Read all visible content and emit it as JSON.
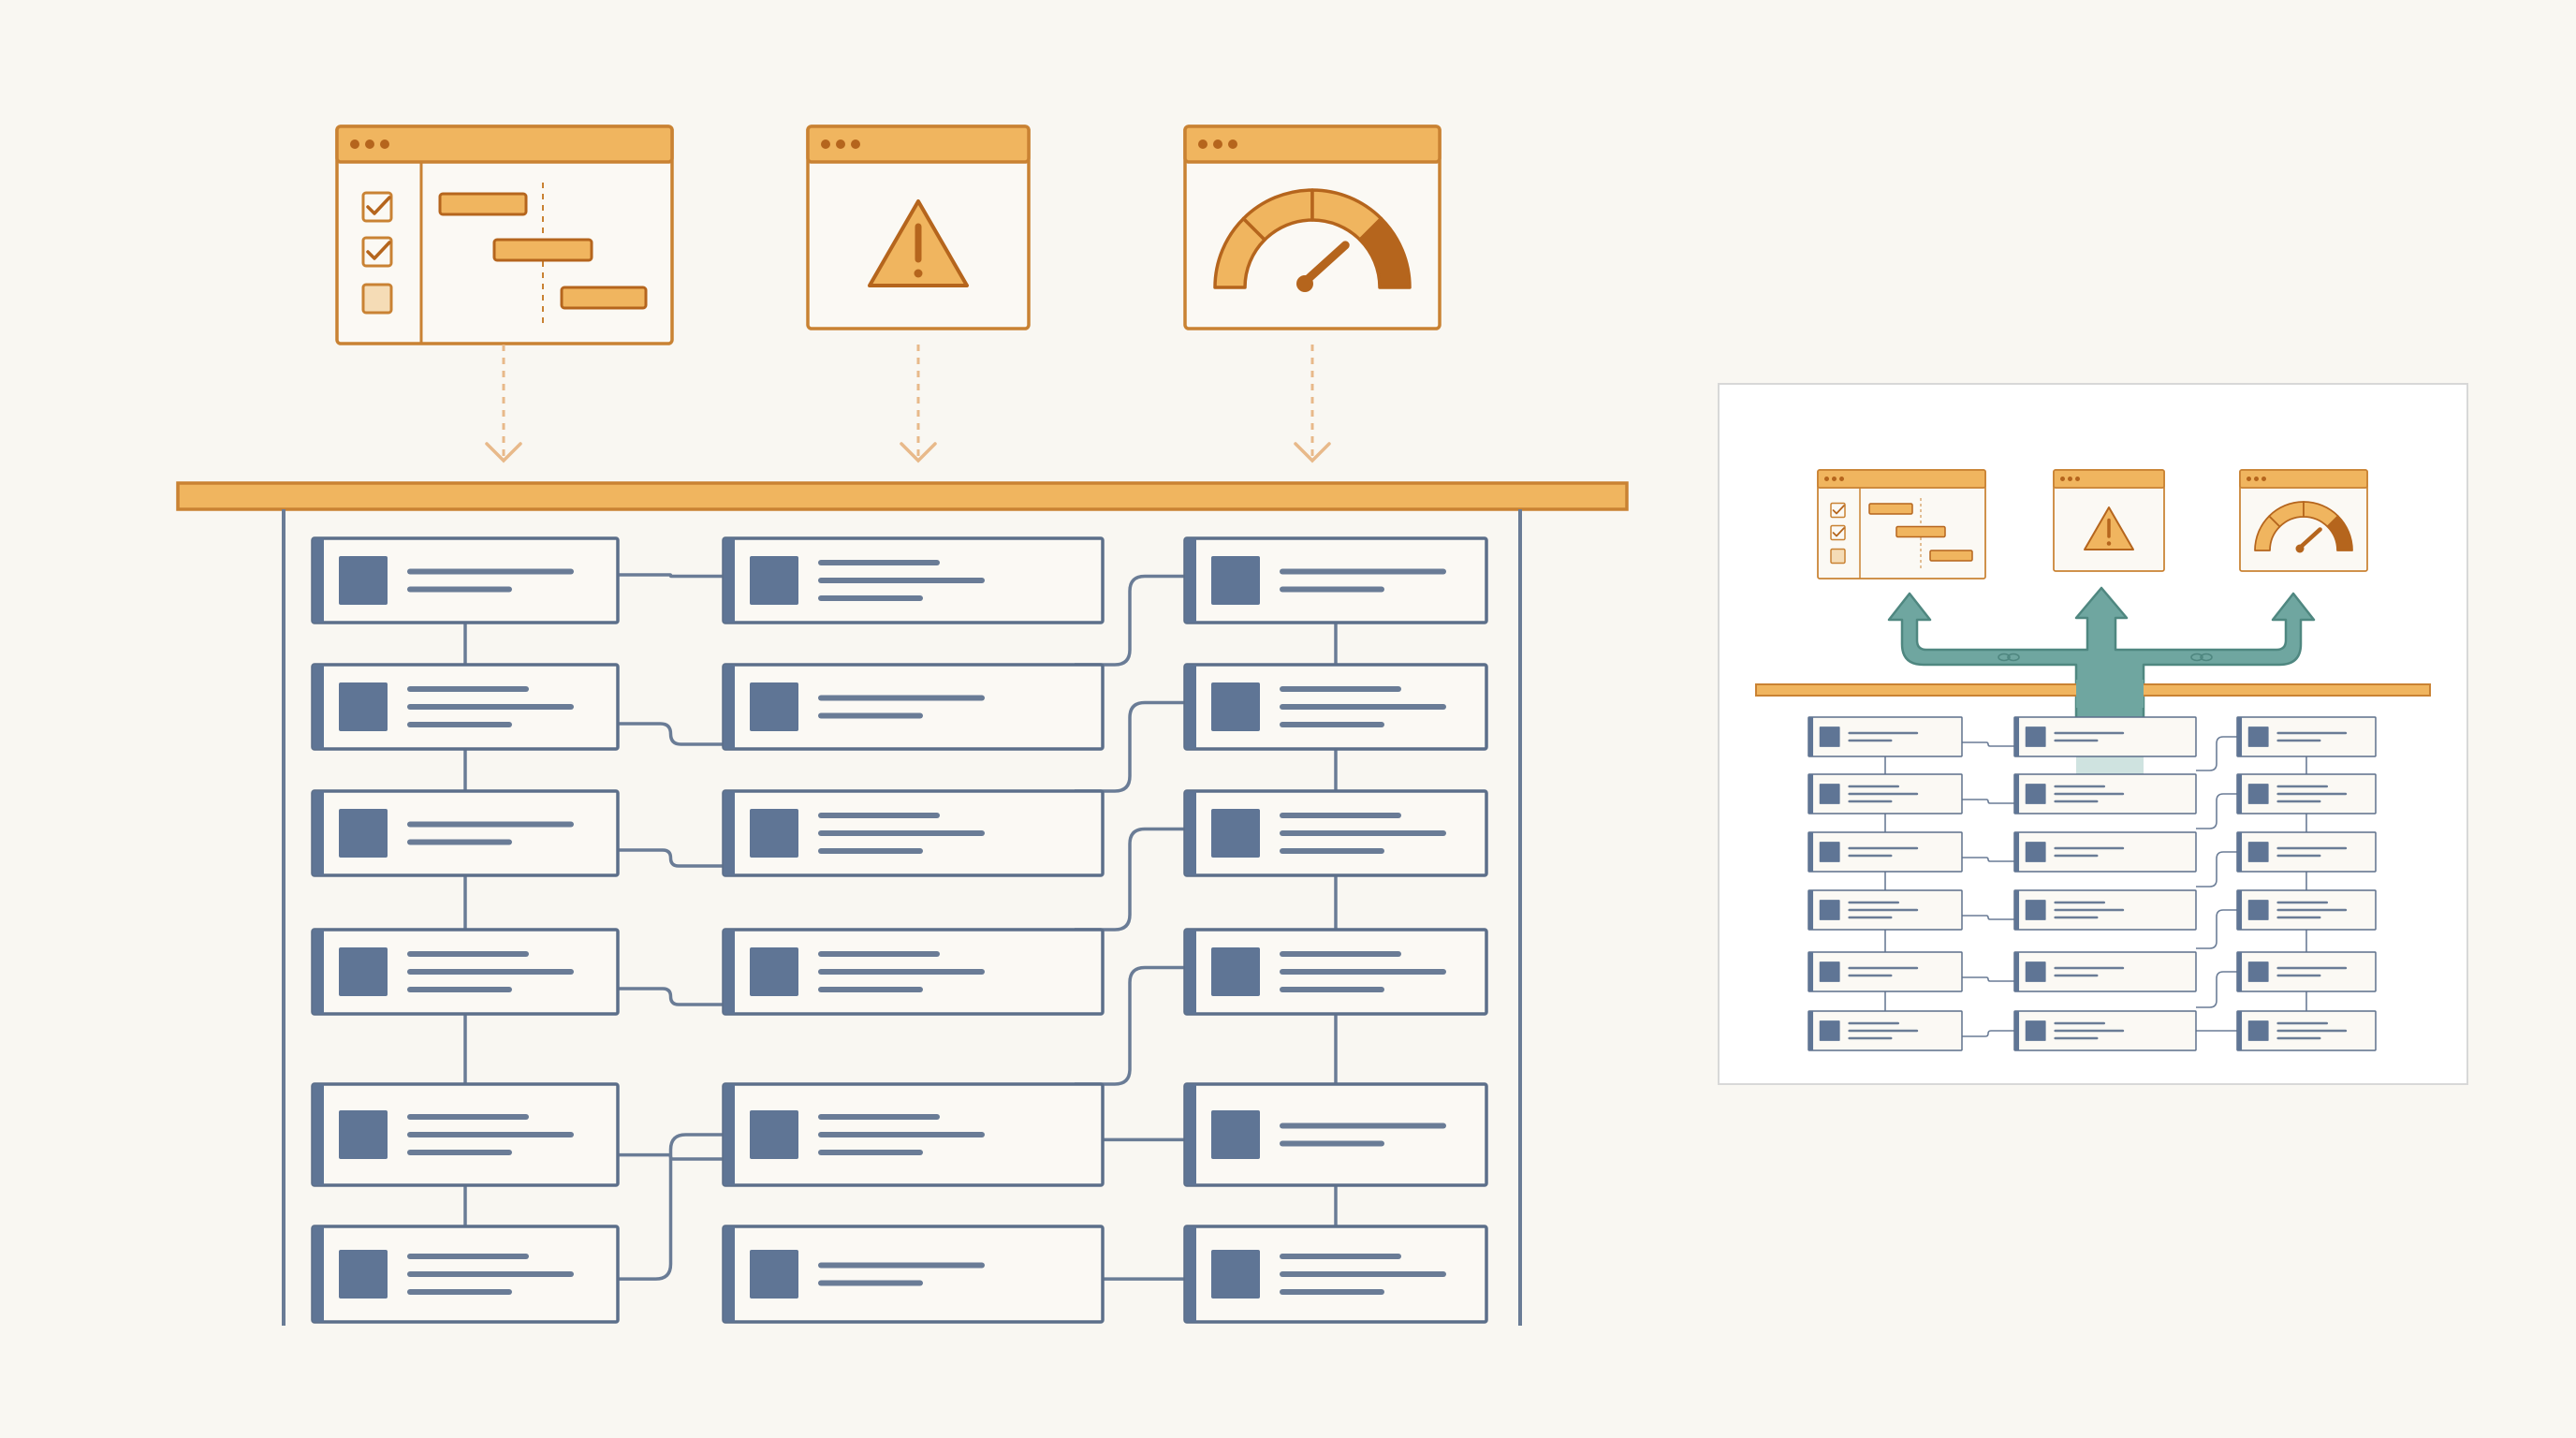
{
  "colors": {
    "background": "#f9f7f2",
    "panel_fill": "#fbf9f4",
    "orange": "#c98233",
    "orange_light": "#f0b55f",
    "orange_dark": "#b5651d",
    "node_stroke": "#5c6f8a",
    "node_fill": "#5f7595",
    "slate_line": "#6a7c96",
    "teal": "#6fa6a0",
    "teal_dark": "#4f8780",
    "teal_light": "#cfe3e0",
    "inset_border": "#d8d8d8",
    "white": "#ffffff"
  },
  "icons": {
    "schedule_window": "gantt-checklist-icon",
    "alert_window": "warning-triangle-icon",
    "gauge_window": "speedometer-gauge-icon",
    "connector": "link-icon"
  },
  "diagram": {
    "columns": 3,
    "rows_per_column": 6,
    "top_windows": [
      "schedule",
      "alert",
      "gauge"
    ],
    "inset_windows": [
      "schedule",
      "alert",
      "gauge"
    ]
  }
}
